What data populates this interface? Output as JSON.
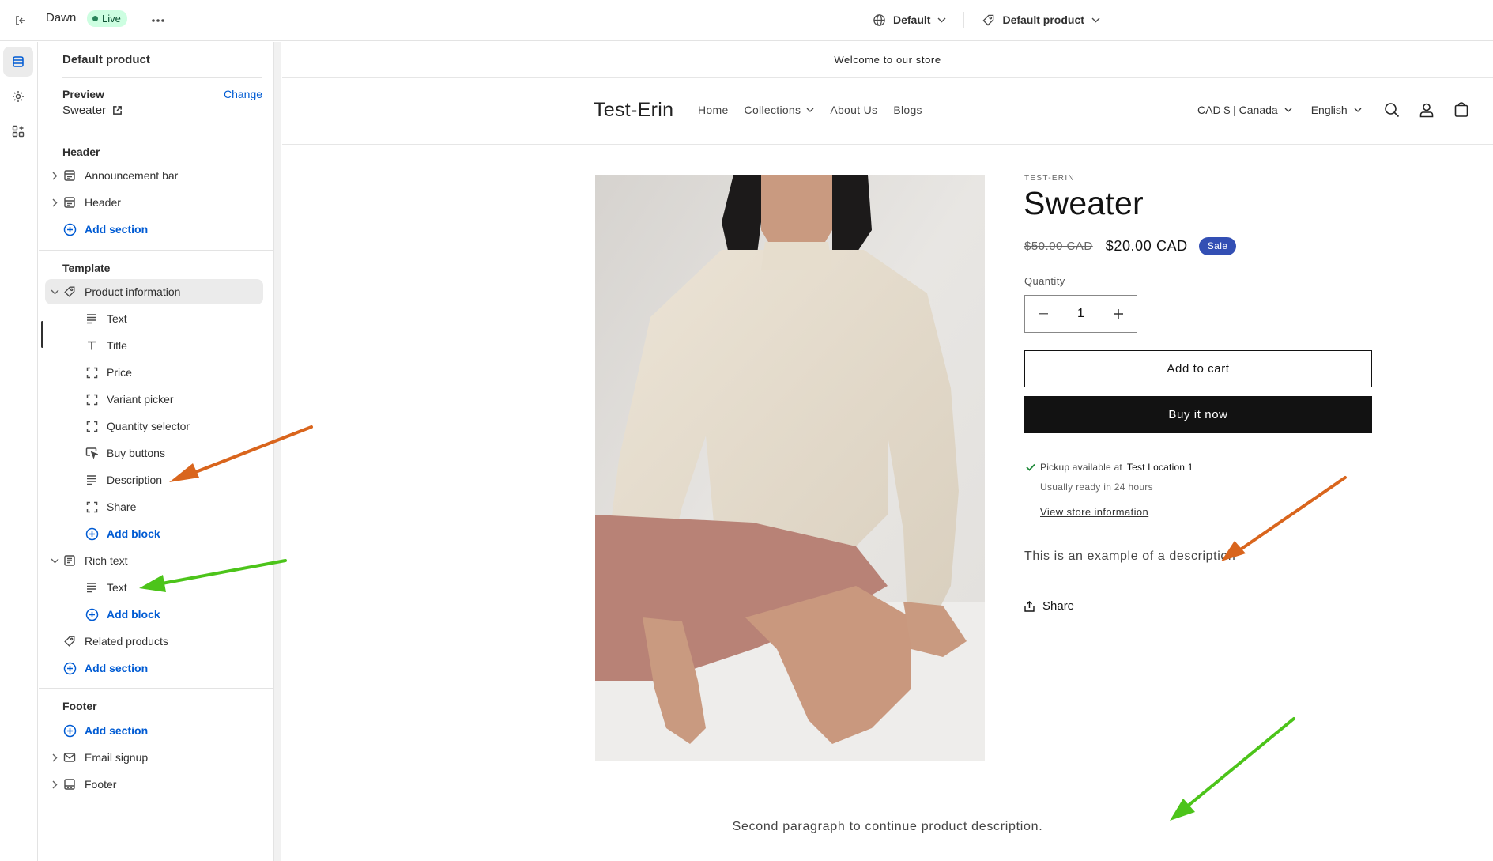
{
  "topbar": {
    "theme_name": "Dawn",
    "live_label": "Live",
    "context_default": "Default",
    "template_default": "Default product"
  },
  "sidebar": {
    "title": "Default product",
    "preview_label": "Preview",
    "change_label": "Change",
    "preview_value": "Sweater",
    "header_group": "Header",
    "header_items": [
      "Announcement bar",
      "Header"
    ],
    "add_section": "Add section",
    "template_group": "Template",
    "product_information": "Product information",
    "product_blocks": [
      "Text",
      "Title",
      "Price",
      "Variant picker",
      "Quantity selector",
      "Buy buttons",
      "Description",
      "Share"
    ],
    "add_block": "Add block",
    "rich_text": "Rich text",
    "rich_text_blocks": [
      "Text"
    ],
    "related_products": "Related products",
    "footer_group": "Footer",
    "footer_items": [
      "Email signup",
      "Footer"
    ]
  },
  "store": {
    "announcement": "Welcome to our store",
    "logo": "Test-Erin",
    "nav": [
      "Home",
      "Collections",
      "About Us",
      "Blogs"
    ],
    "currency": "CAD $ | Canada",
    "language": "English",
    "product": {
      "vendor": "TEST-ERIN",
      "title": "Sweater",
      "price_old": "$50.00 CAD",
      "price_new": "$20.00 CAD",
      "sale_badge": "Sale",
      "quantity_label": "Quantity",
      "quantity_value": "1",
      "add_to_cart": "Add to cart",
      "buy_now": "Buy it now",
      "pickup_prefix": "Pickup available at",
      "pickup_location": "Test Location 1",
      "pickup_ready": "Usually ready in 24 hours",
      "view_store": "View store information",
      "description": "This is an example of a description",
      "share": "Share"
    },
    "second_paragraph": "Second paragraph to continue product description."
  },
  "colors": {
    "accent_link": "#005bd3",
    "sale_badge": "#334fb4",
    "live_badge_bg": "#cdfee1",
    "arrow_orange": "#d9651d",
    "arrow_green": "#4cc41a"
  }
}
